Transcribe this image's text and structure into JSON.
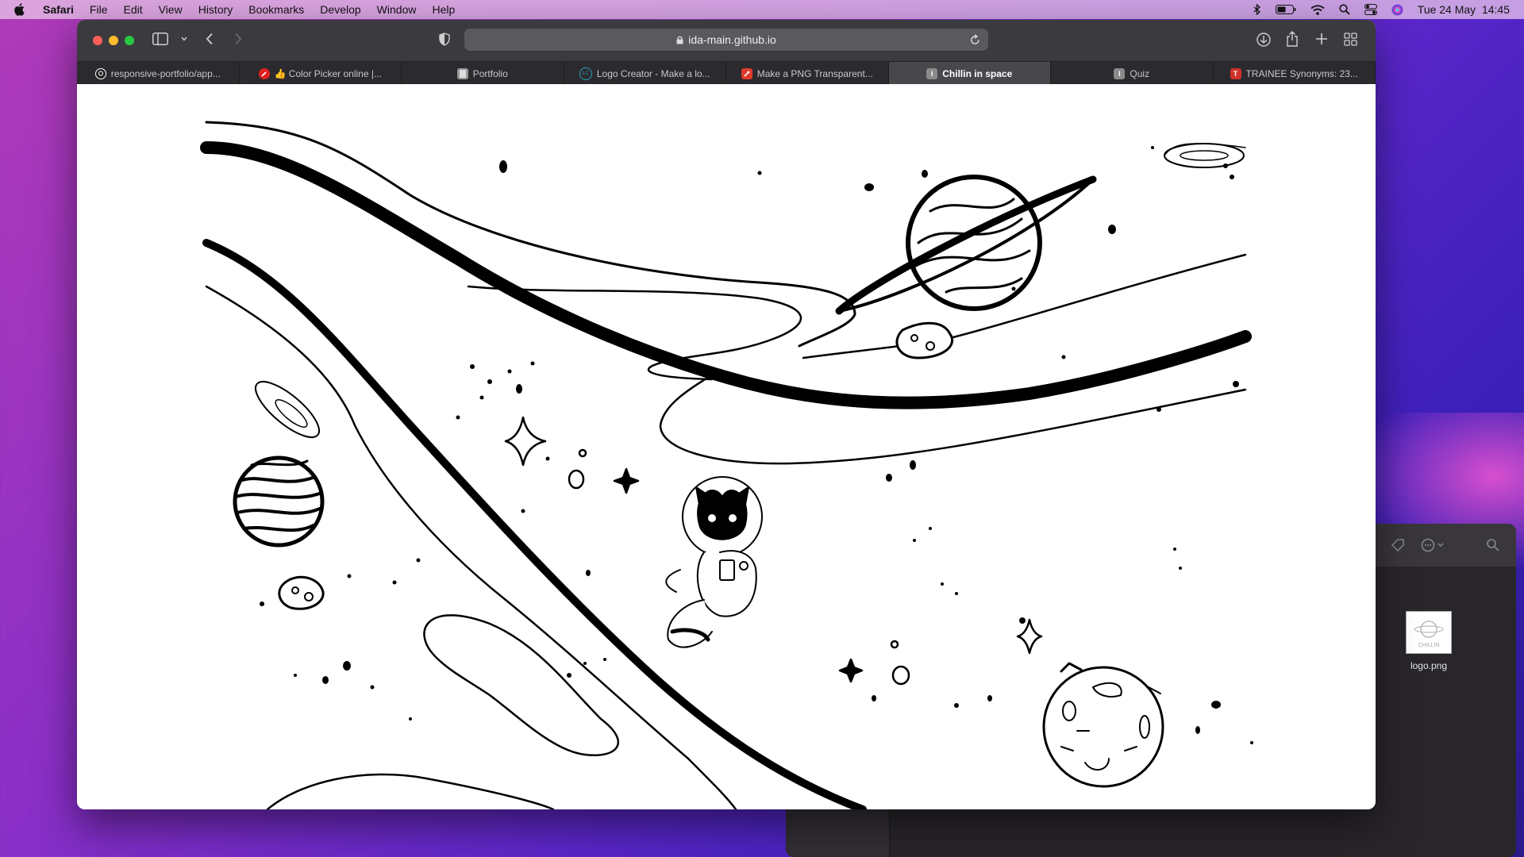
{
  "menubar": {
    "app_name": "Safari",
    "items": [
      "File",
      "Edit",
      "View",
      "History",
      "Bookmarks",
      "Develop",
      "Window",
      "Help"
    ],
    "clock": "Tue 24 May  14:45",
    "icons": [
      "bluetooth-icon",
      "battery-icon",
      "wifi-icon",
      "search-icon",
      "control-center-icon",
      "siri-icon"
    ]
  },
  "browser": {
    "address": "ida-main.github.io",
    "tabs": [
      {
        "label": "responsive-portfolio/app...",
        "icon": "github-icon",
        "color": "#ffffff"
      },
      {
        "label": "👍 Color Picker online |...",
        "icon": "color-picker-icon",
        "color": "#e02020"
      },
      {
        "label": "Portfolio",
        "icon": "page-icon",
        "color": "#999999"
      },
      {
        "label": "Logo Creator - Make a lo...",
        "icon": "logo-creator-icon",
        "color": "#2aa0c0"
      },
      {
        "label": "Make a PNG Transparent...",
        "icon": "tool-icon",
        "color": "#e03a2a"
      },
      {
        "label": "Chillin in space",
        "icon": "page-icon",
        "color": "#888888",
        "active": true
      },
      {
        "label": "Quiz",
        "icon": "page-icon",
        "color": "#888888"
      },
      {
        "label": "TRAINEE Synonyms: 23...",
        "icon": "thesaurus-icon",
        "color": "#d0302a"
      }
    ]
  },
  "page": {
    "illustration": "astronaut-cat-space-illustration"
  },
  "finder": {
    "file_name": "logo.png",
    "thumb_text": "CHILLIN"
  }
}
